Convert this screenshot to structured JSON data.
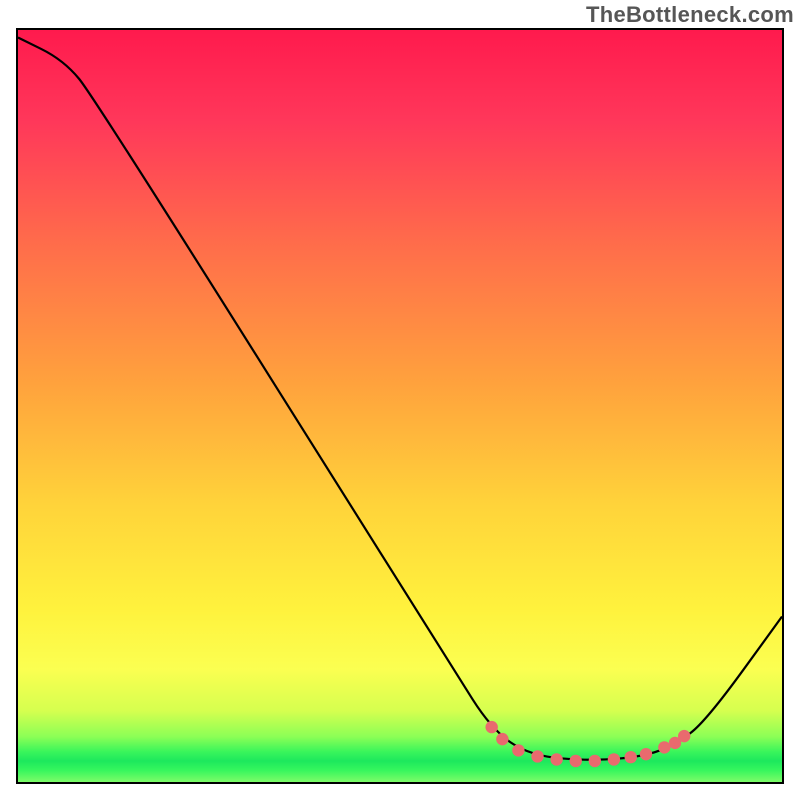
{
  "watermark": "TheBottleneck.com",
  "chart_data": {
    "type": "line",
    "title": "",
    "xlabel": "",
    "ylabel": "",
    "xlim": [
      0,
      100
    ],
    "ylim": [
      0,
      100
    ],
    "curve": [
      {
        "x": 0,
        "y": 99
      },
      {
        "x": 6,
        "y": 96
      },
      {
        "x": 10,
        "y": 91
      },
      {
        "x": 57,
        "y": 15
      },
      {
        "x": 62,
        "y": 7
      },
      {
        "x": 67,
        "y": 3.5
      },
      {
        "x": 75,
        "y": 2.8
      },
      {
        "x": 82,
        "y": 3.4
      },
      {
        "x": 86,
        "y": 5
      },
      {
        "x": 90,
        "y": 8
      },
      {
        "x": 100,
        "y": 22
      }
    ],
    "highlight_points": [
      {
        "x": 62.0,
        "y": 7.3
      },
      {
        "x": 63.4,
        "y": 5.7
      },
      {
        "x": 65.5,
        "y": 4.2
      },
      {
        "x": 68.0,
        "y": 3.4
      },
      {
        "x": 70.5,
        "y": 3.0
      },
      {
        "x": 73.0,
        "y": 2.8
      },
      {
        "x": 75.5,
        "y": 2.8
      },
      {
        "x": 78.0,
        "y": 3.0
      },
      {
        "x": 80.2,
        "y": 3.3
      },
      {
        "x": 82.2,
        "y": 3.7
      },
      {
        "x": 84.6,
        "y": 4.6
      },
      {
        "x": 86.0,
        "y": 5.2
      },
      {
        "x": 87.2,
        "y": 6.1
      }
    ],
    "gradient_bands": [
      {
        "color": "#ff1a4d",
        "position_pct": 0
      },
      {
        "color": "#ffa23d",
        "position_pct": 47
      },
      {
        "color": "#fff23d",
        "position_pct": 77
      },
      {
        "color": "#1de85d",
        "position_pct": 97
      }
    ]
  }
}
